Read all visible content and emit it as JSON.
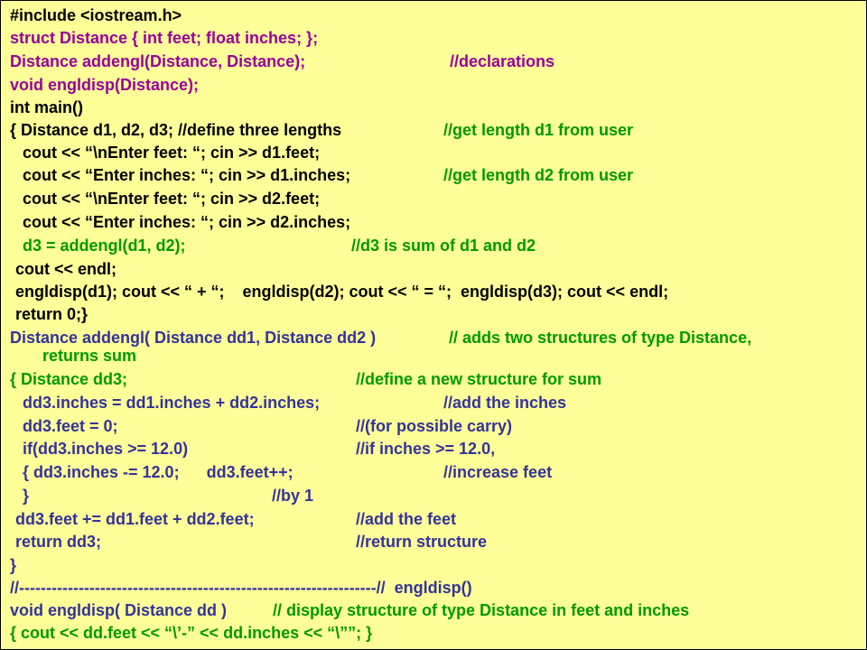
{
  "colors": {
    "background": "#ffff99",
    "black": "#000000",
    "purple": "#990099",
    "green": "#009900",
    "blue": "#333399"
  },
  "code": {
    "l1": "#include <iostream.h>",
    "l2": "struct Distance { int feet; float inches; };",
    "l3": "Distance addengl(Distance, Distance);",
    "l3c": "//declarations",
    "l4": "void engldisp(Distance);",
    "l5": "int main()",
    "l6": "{ Distance d1, d2, d3; //define three lengths",
    "l6c": "//get length d1 from user",
    "l7": "cout << “\\nEnter feet: “; cin >> d1.feet;",
    "l8": "cout << “Enter inches: “; cin >> d1.inches;",
    "l8c": "//get length d2 from user",
    "l9": "cout << “\\nEnter feet: “; cin >> d2.feet;",
    "l10": "cout << “Enter inches: “; cin >> d2.inches;",
    "l11": "d3 = addengl(d1, d2);",
    "l11c": "//d3 is sum of d1 and d2",
    "l12": "cout << endl;",
    "l13": "engldisp(d1); cout << “ + “;    engldisp(d2); cout << “ = “;  engldisp(d3); cout << endl;",
    "l14": "return 0;}",
    "l15a": "Distance addengl( Distance dd1, Distance dd2 )",
    "l15c": "// adds two structures of type Distance,",
    "l15d": "returns sum",
    "l16": "{ Distance dd3;",
    "l16c": "//define a new structure for sum",
    "l17": "dd3.inches = dd1.inches + dd2.inches;",
    "l17c": "//add the inches",
    "l18": "dd3.feet = 0;",
    "l18c": "//(for possible carry)",
    "l19": "if(dd3.inches >= 12.0)",
    "l19c": "//if inches >= 12.0,",
    "l20": "{ dd3.inches -= 12.0;      dd3.feet++;",
    "l20c": "//increase feet",
    "l21": "}",
    "l21c": "//by 1",
    "l22": "dd3.feet += dd1.feet + dd2.feet;",
    "l22c": "//add the feet",
    "l23": "return dd3;",
    "l23c": "//return structure",
    "l24": "}",
    "l25": "//------------------------------------------------------------------//  engldisp()",
    "l26a": "void engldisp( Distance dd )",
    "l26c": "// display structure of type Distance in feet and inches",
    "l27": "{ cout << dd.feet << “\\’-” << dd.inches << “\\””; }"
  }
}
